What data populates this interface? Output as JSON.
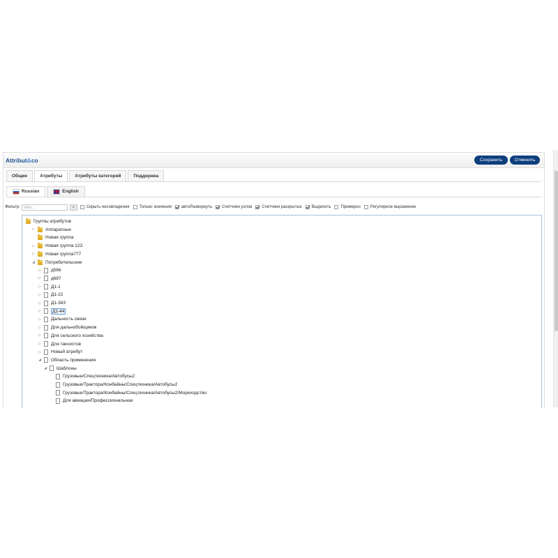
{
  "header": {
    "logo_main": "Attribut",
    "logo_amp": "&",
    "logo_end": "co",
    "save_label": "Сохранить",
    "cancel_label": "Отменить"
  },
  "tabs": [
    {
      "label": "Общие"
    },
    {
      "label": "Атрибуты"
    },
    {
      "label": "Атрибуты категорий"
    },
    {
      "label": "Поддержка"
    }
  ],
  "lang_tabs": [
    {
      "label": "Russian"
    },
    {
      "label": "English"
    }
  ],
  "filter": {
    "label": "Фильтр:",
    "placeholder": "Filter...",
    "clear_glyph": "×",
    "options": [
      {
        "label": "Скрыть несовпадения",
        "checked": false
      },
      {
        "label": "Только значения",
        "checked": false
      },
      {
        "label": "автоРазвернуть",
        "checked": true
      },
      {
        "label": "Счетчики узлов",
        "checked": true
      },
      {
        "label": "Счетчики раскрытых",
        "checked": true
      },
      {
        "label": "Выделить",
        "checked": true
      },
      {
        "label": "Примерно",
        "checked": false
      },
      {
        "label": "Регулярное выражение",
        "checked": false
      }
    ]
  },
  "tree": [
    {
      "label": "Группы атрибутов",
      "icon": "folder",
      "level": 0,
      "arrow": ""
    },
    {
      "label": "Аппаратные",
      "icon": "folder",
      "level": 1,
      "arrow": "▷"
    },
    {
      "label": "Новая группа",
      "icon": "folder",
      "level": 1,
      "arrow": ""
    },
    {
      "label": "Новая группа 123",
      "icon": "folder",
      "level": 1,
      "arrow": "▷"
    },
    {
      "label": "Новая группа777",
      "icon": "folder",
      "level": 1,
      "arrow": "▷"
    },
    {
      "label": "Потребительские",
      "icon": "folder",
      "level": 1,
      "arrow": "◢"
    },
    {
      "label": "д566",
      "icon": "doc",
      "level": 2,
      "arrow": "▷"
    },
    {
      "label": "д687",
      "icon": "doc",
      "level": 2,
      "arrow": "▷"
    },
    {
      "label": "Д1-1",
      "icon": "doc",
      "level": 2,
      "arrow": "▷"
    },
    {
      "label": "Д1-22",
      "icon": "doc",
      "level": 2,
      "arrow": "▷"
    },
    {
      "label": "Д1-3й3",
      "icon": "doc",
      "level": 2,
      "arrow": "▷"
    },
    {
      "label": "Д1-44",
      "icon": "doc",
      "level": 2,
      "arrow": "▷",
      "selected": true
    },
    {
      "label": "Дальность связи",
      "icon": "doc",
      "level": 2,
      "arrow": "▷"
    },
    {
      "label": "Для дальнобойщиков",
      "icon": "doc",
      "level": 2,
      "arrow": "▷"
    },
    {
      "label": "Для сельского хозяйства",
      "icon": "doc",
      "level": 2,
      "arrow": "▷"
    },
    {
      "label": "Для таксистов",
      "icon": "doc",
      "level": 2,
      "arrow": "▷"
    },
    {
      "label": "Новый атрибут",
      "icon": "doc",
      "level": 2,
      "arrow": "▷"
    },
    {
      "label": "Область применения",
      "icon": "doc",
      "level": 2,
      "arrow": "◢"
    },
    {
      "label": "Шаблоны",
      "icon": "doc",
      "level": 3,
      "arrow": "◢"
    },
    {
      "label": "Грузовые/Спецтехника/Автобусы2",
      "icon": "doc",
      "level": 4,
      "arrow": ""
    },
    {
      "label": "Грузовые/Трактора/Конбайны/Спецтехника/Автобусы2",
      "icon": "doc",
      "level": 4,
      "arrow": ""
    },
    {
      "label": "Грузовые/Трактора/Конбайны/Спецтехника/Автобусы2/Мореходство",
      "icon": "doc",
      "level": 4,
      "arrow": ""
    },
    {
      "label": "Для авиации/Профессиональная",
      "icon": "doc",
      "level": 4,
      "arrow": ""
    }
  ],
  "colors": {
    "accent": "#0d3e7e",
    "logo": "#1c4f8c",
    "tree_border": "#a8c0dc"
  }
}
